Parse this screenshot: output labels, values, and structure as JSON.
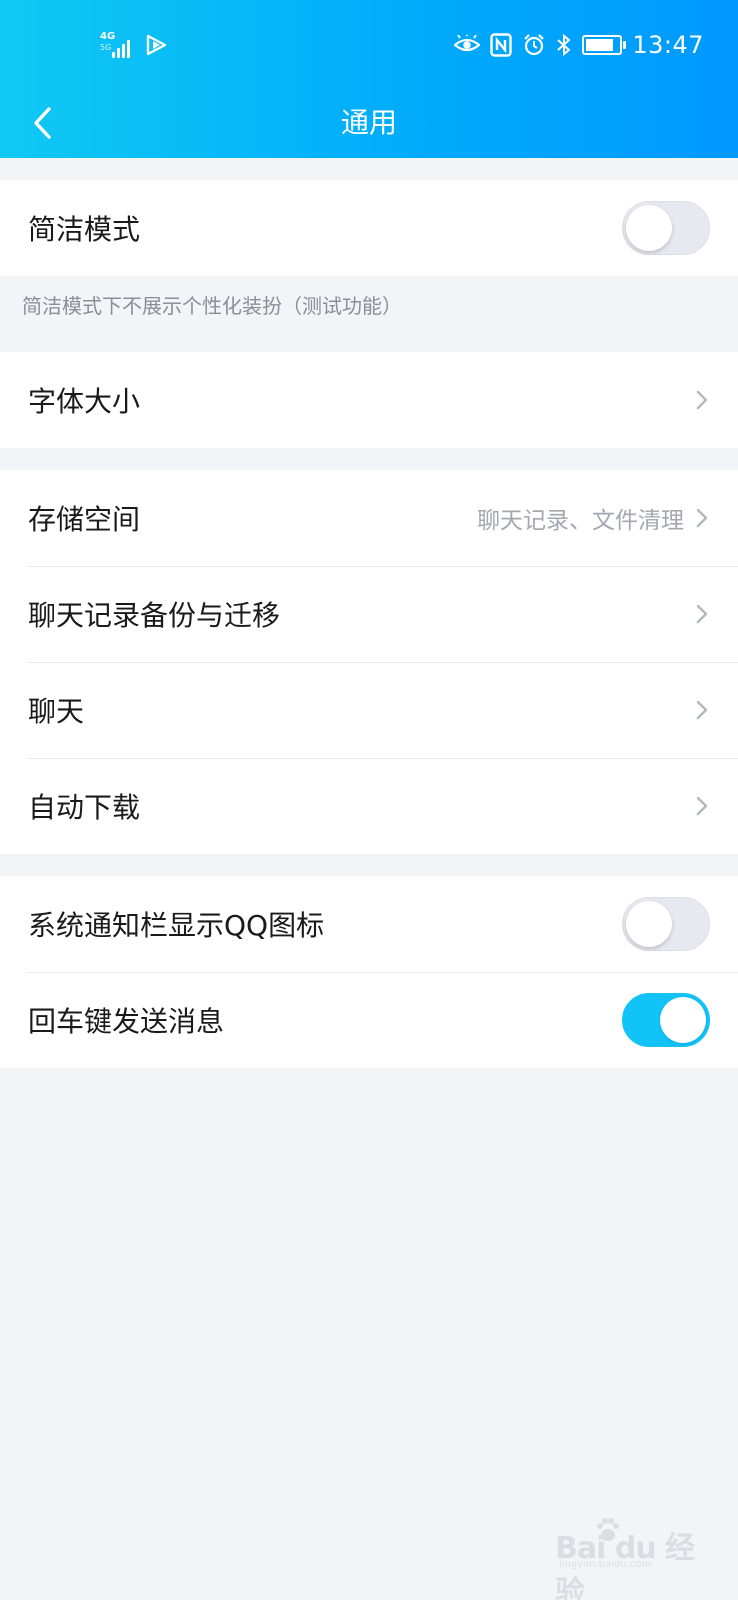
{
  "status_bar": {
    "network": "4G",
    "network_sub": "5G",
    "time": "13:47",
    "battery_level": 0.85
  },
  "nav": {
    "title": "通用"
  },
  "simple_mode": {
    "label": "简洁模式",
    "enabled": false,
    "description": "简洁模式下不展示个性化装扮（测试功能）"
  },
  "font_size": {
    "label": "字体大小"
  },
  "storage_group": {
    "items": [
      {
        "label": "存储空间",
        "hint": "聊天记录、文件清理"
      },
      {
        "label": "聊天记录备份与迁移"
      },
      {
        "label": "聊天"
      },
      {
        "label": "自动下载"
      }
    ]
  },
  "toggles_group": {
    "items": [
      {
        "label": "系统通知栏显示QQ图标",
        "enabled": false
      },
      {
        "label": "回车键发送消息",
        "enabled": true
      }
    ]
  },
  "watermark": {
    "text": "Bai du 经验",
    "sub": "jingyan.baidu.com"
  },
  "colors": {
    "header_start": "#10c9f3",
    "header_end": "#0099ff",
    "toggle_on": "#12c3f7",
    "background": "#f3f4f8"
  }
}
